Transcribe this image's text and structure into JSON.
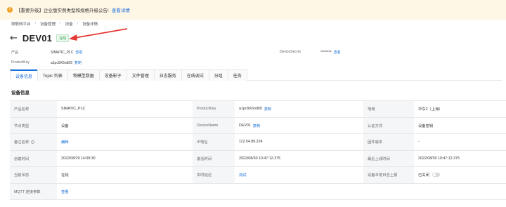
{
  "notice": {
    "text": "【重要升级】企业版实例类型和规格升级公告!",
    "link": "查看详情"
  },
  "breadcrumb": [
    "物联网平台",
    "设备管理",
    "设备",
    "设备详情"
  ],
  "title": "DEV01",
  "status_badge": "在线",
  "meta": {
    "product_label": "产品",
    "product_value": "SIMATIC_PLC",
    "product_action": "查看",
    "productkey_label": "ProductKey",
    "productkey_value": "a1pc9X6nd09",
    "productkey_action": "复制",
    "devicesecret_label": "DeviceSecret",
    "devicesecret_value": "********",
    "devicesecret_action": "查看"
  },
  "tabs": [
    "设备信息",
    "Topic 列表",
    "物模型数据",
    "设备影子",
    "文件管理",
    "日志服务",
    "在线调试",
    "分组",
    "任务"
  ],
  "section_title": "设备信息",
  "table": {
    "r1": {
      "l1": "产品名称",
      "v1": "SIMATIC_PLC",
      "l2": "ProductKey",
      "v2": "a1pc9X6nd09",
      "v2_action": "复制",
      "l3": "地域",
      "v3": "华东2（上海）"
    },
    "r2": {
      "l1": "节点类型",
      "v1": "设备",
      "l2": "DeviceName",
      "v2": "DEV01",
      "v2_action": "复制",
      "l3": "认证方式",
      "v3": "设备密钥"
    },
    "r3": {
      "l1": "备注名称",
      "v1": "编辑",
      "l2": "IP地址",
      "v2": "112.54.89.224",
      "l3": "固件版本",
      "v3": "-"
    },
    "r4": {
      "l1": "创建时间",
      "v1": "2022/08/29 14:09:30",
      "l2": "激活时间",
      "v2": "2022/08/30 10:47:12.375",
      "l3": "最后上线时间",
      "v3": "2022/08/30 10:47:12.375"
    },
    "r5": {
      "l1": "当前状态",
      "v1": "在线",
      "l2": "实时延迟",
      "v2": "测试",
      "l3": "设备本地日志上报",
      "v3": "已关闭"
    },
    "r6": {
      "l1": "MQTT 连接参数",
      "v1": "查看"
    }
  }
}
